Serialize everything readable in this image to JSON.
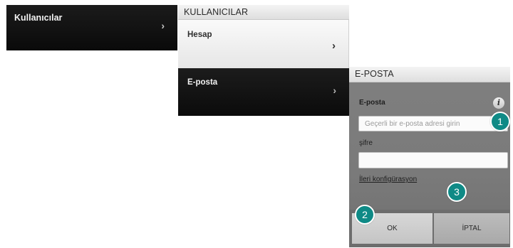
{
  "panel1": {
    "label": "Kullanıcılar",
    "chevron": "›"
  },
  "panel2": {
    "header": "KULLANICILAR",
    "items": [
      {
        "label": "Hesap",
        "chevron": "›"
      },
      {
        "label": "E-posta",
        "chevron": "›"
      }
    ]
  },
  "dialog": {
    "header": "E-POSTA",
    "email_label": "E-posta",
    "info_icon": "i",
    "email_placeholder": "Geçerli bir e-posta adresi girin",
    "password_label": "şifre",
    "password_value": "",
    "advanced_link": "İleri konfigürasyon",
    "ok_label": "OK",
    "cancel_label": "İPTAL"
  },
  "callouts": [
    "1",
    "2",
    "3"
  ],
  "colors": {
    "callout": "#0f8a86",
    "dark_panel": "#111111",
    "dialog_bg": "#7c7c7c"
  }
}
